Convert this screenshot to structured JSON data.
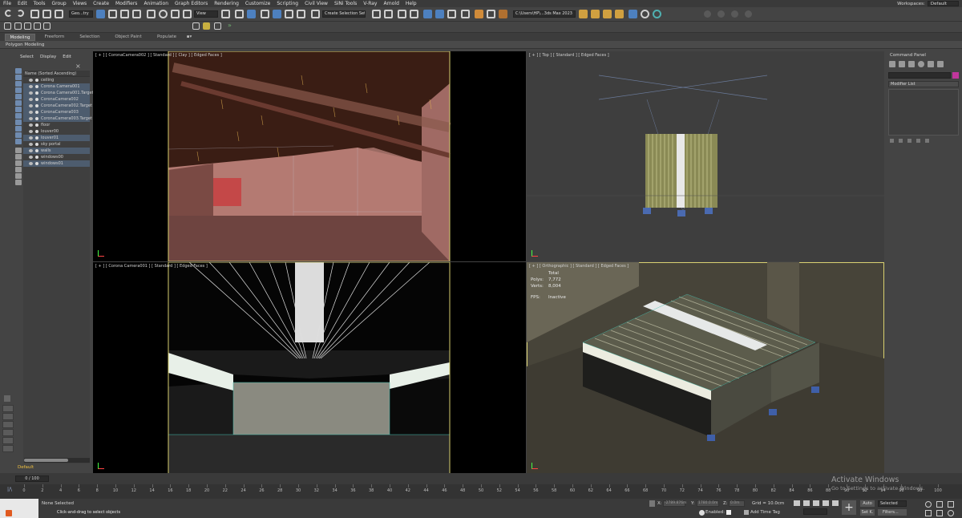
{
  "menu": [
    "File",
    "Edit",
    "Tools",
    "Group",
    "Views",
    "Create",
    "Modifiers",
    "Animation",
    "Graph Editors",
    "Rendering",
    "Customize",
    "Scripting",
    "Civil View",
    "SiNi Tools",
    "V-Ray",
    "Arnold",
    "Help"
  ],
  "workspace": {
    "label": "Workspaces:",
    "value": "Default"
  },
  "toolbar": {
    "filter_dropdown": "Geo...try",
    "refcoord_dropdown": "View",
    "selection_set": "Create Selection Set",
    "path_dropdown": "C:\\Users\\HP\\...3ds Max 2023"
  },
  "ribbon": {
    "tabs": [
      "Modeling",
      "Freeform",
      "Selection",
      "Object Paint",
      "Populate"
    ],
    "active_tab": "Modeling",
    "panel_label": "Polygon Modeling"
  },
  "scene_explorer": {
    "menu": [
      "Select",
      "Display",
      "Edit"
    ],
    "header": "Name (Sorted Ascending)",
    "items": [
      {
        "name": "ceiling",
        "type": "geo",
        "selected": false
      },
      {
        "name": "Corona Camera001",
        "type": "cam",
        "selected": true
      },
      {
        "name": "Corona Camera001.Target",
        "type": "tgt",
        "selected": true
      },
      {
        "name": "CoronaCamera002",
        "type": "cam",
        "selected": true
      },
      {
        "name": "CoronaCamera002.Target",
        "type": "tgt",
        "selected": true
      },
      {
        "name": "CoronaCamera003",
        "type": "cam",
        "selected": true
      },
      {
        "name": "CoronaCamera003.Target",
        "type": "tgt",
        "selected": true
      },
      {
        "name": "floor",
        "type": "geo",
        "selected": false
      },
      {
        "name": "louver00",
        "type": "geo",
        "selected": false
      },
      {
        "name": "louver01",
        "type": "geo",
        "selected": true
      },
      {
        "name": "sky portal",
        "type": "geo",
        "selected": false
      },
      {
        "name": "walls",
        "type": "geo",
        "selected": true
      },
      {
        "name": "windows00",
        "type": "geo",
        "selected": false
      },
      {
        "name": "windows01",
        "type": "geo",
        "selected": true
      }
    ],
    "layer": "Default"
  },
  "viewports": {
    "top_left": "[ + ] [ CoronaCamera002 ] [ Standard ] [ Clay ] [ Edged Faces ]",
    "top_right": "[ + ] [ Top ] [ Standard ] [ Edged Faces ]",
    "bottom_left": "[ + ] [ Corona Camera001 ] [ Standard ] [ Edged Faces ]",
    "bottom_right": "[ + ] [ Orthographic ] [ Standard ] [ Edged Faces ]"
  },
  "stats": {
    "title": "Total",
    "polys_label": "Polys:",
    "polys_value": "7,772",
    "verts_label": "Verts:",
    "verts_value": "8,004",
    "fps_label": "FPS:",
    "fps_value": "Inactive"
  },
  "command_panel": {
    "title": "Command Panel",
    "modifier_list": "Modifier List"
  },
  "timeline": {
    "range": "0 / 100",
    "ticks": [
      0,
      2,
      4,
      6,
      8,
      10,
      12,
      14,
      16,
      18,
      20,
      22,
      24,
      26,
      28,
      30,
      32,
      34,
      36,
      38,
      40,
      42,
      44,
      46,
      48,
      50,
      52,
      54,
      56,
      58,
      60,
      62,
      64,
      66,
      68,
      70,
      72,
      74,
      76,
      78,
      80,
      82,
      84,
      86,
      88,
      90,
      92,
      94,
      96,
      98,
      100
    ]
  },
  "status": {
    "selection": "None Selected",
    "prompt": "Click-and-drag to select objects",
    "x_label": "X:",
    "x_value": "-2789.876m",
    "y_label": "Y:",
    "y_value": "1780.0.0m",
    "z_label": "Z:",
    "z_value": "0.0m",
    "grid": "Grid = 10.0cm",
    "enabled_label": "Enabled:",
    "add_time_tag": "Add Time Tag",
    "auto_key": "Auto",
    "set_key": "Set K.",
    "key_filter": "Selected",
    "filters": "Filters..."
  },
  "watermark": {
    "title": "Activate Windows",
    "sub": "Go to Settings to activate Windows."
  }
}
